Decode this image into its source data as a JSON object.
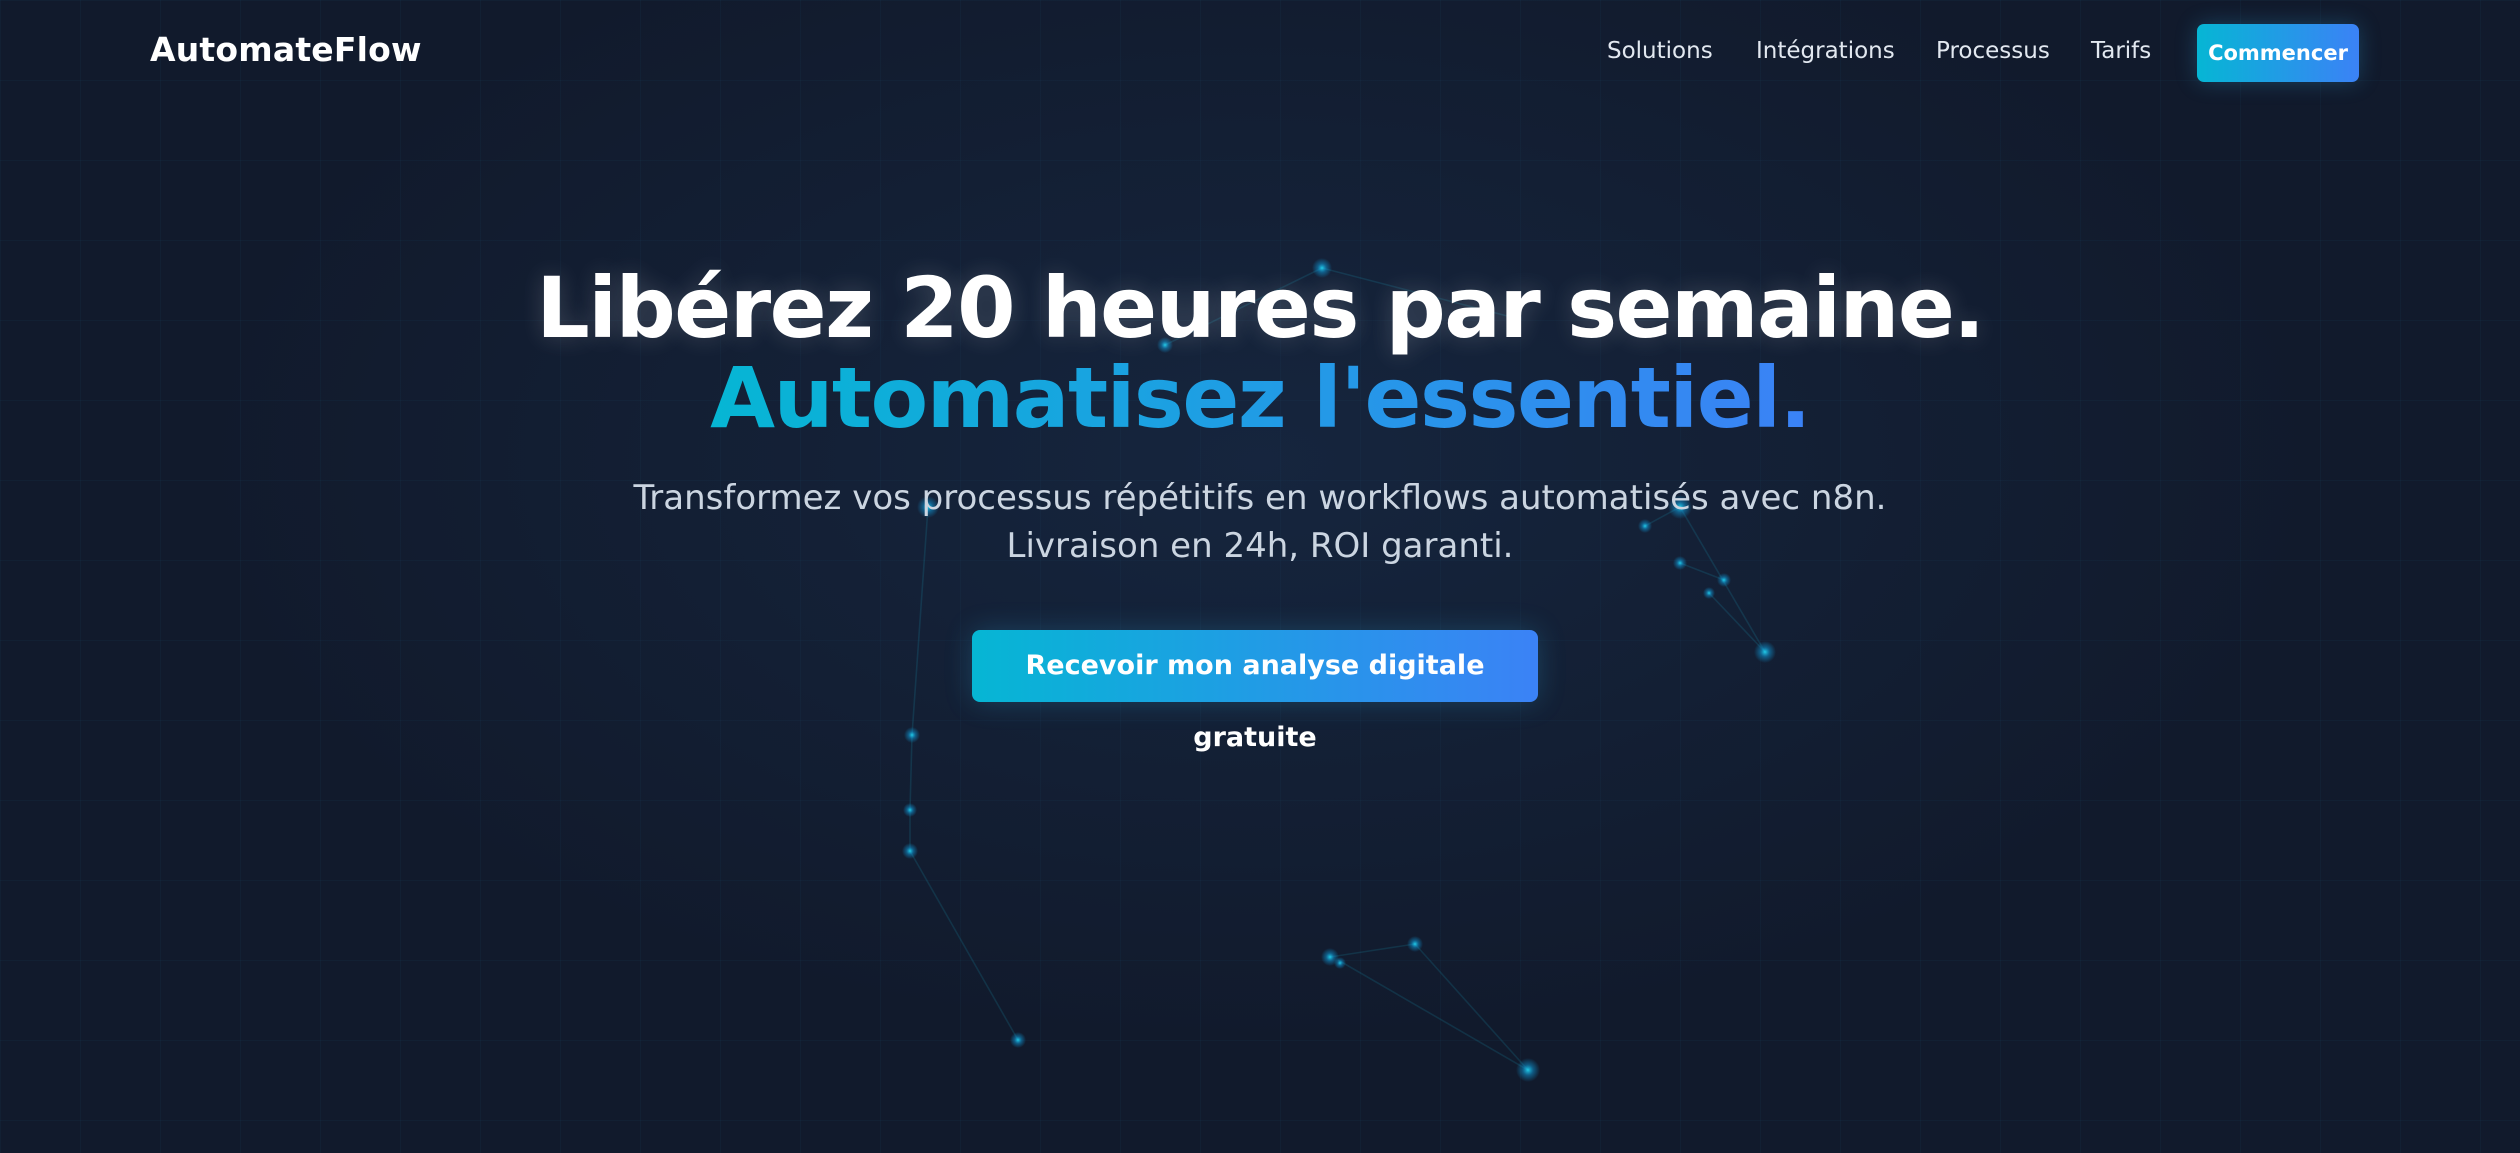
{
  "brand": {
    "name": "AutomateFlow"
  },
  "nav": {
    "links": [
      {
        "label": "Solutions"
      },
      {
        "label": "Intégrations"
      },
      {
        "label": "Processus"
      },
      {
        "label": "Tarifs"
      }
    ],
    "cta_label": "Commencer"
  },
  "hero": {
    "title_line1": "Libérez 20 heures par semaine.",
    "title_line2": "Automatisez l'essentiel.",
    "subtitle": "Transformez vos processus répétitifs en workflows automatisés avec n8n. Livraison en 24h, ROI garanti.",
    "cta_label": "Recevoir mon analyse digitale gratuite"
  },
  "colors": {
    "background": "#111a2c",
    "accent_start": "#06b6d4",
    "accent_end": "#3b82f6",
    "nav_text": "#e2e8f0",
    "subtitle_text": "#cbd5e1",
    "node_glow": "#22d3ee"
  },
  "icons": {
    "background_decoration": "network-nodes"
  }
}
